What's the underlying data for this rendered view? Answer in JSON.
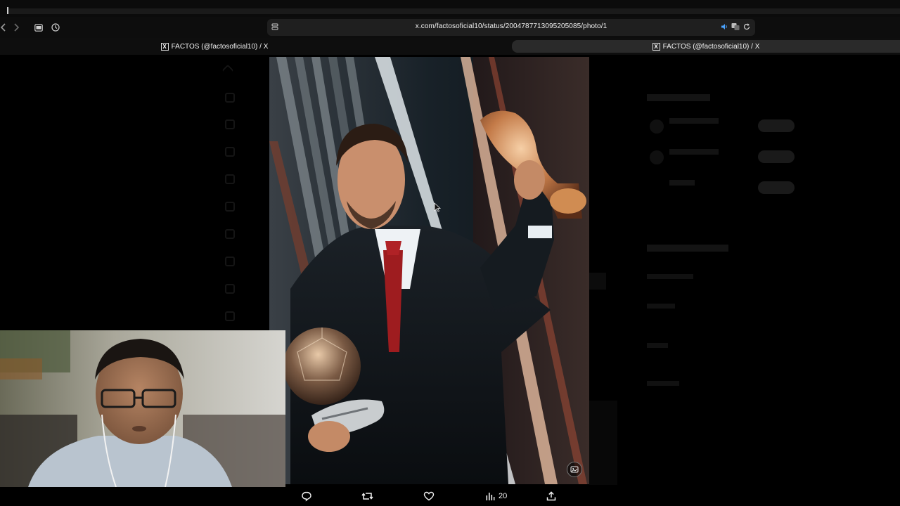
{
  "browser": {
    "url": "x.com/factosoficial10/status/2004787713095205085/photo/1",
    "tabs": [
      {
        "title": "FACTOS (@factosoficial10) / X",
        "active": false
      },
      {
        "title": "FACTOS (@factosoficial10) / X",
        "active": true
      }
    ],
    "icons": [
      "back-icon",
      "forward-icon",
      "sidebar-icon",
      "history-icon",
      "site-settings-icon",
      "speaker-icon",
      "translate-icon",
      "reload-icon"
    ]
  },
  "photo_viewer": {
    "alt_icon": "image-alt-icon"
  },
  "actions": {
    "reply_icon": "reply-icon",
    "repost_icon": "repost-icon",
    "like_icon": "heart-icon",
    "views_icon": "views-icon",
    "views_count": "20",
    "share_icon": "share-icon"
  },
  "colors": {
    "background": "#000000",
    "text": "#e7e9ea",
    "url_bar": "#1f1f1f",
    "active_tab": "#2a2a2a"
  }
}
